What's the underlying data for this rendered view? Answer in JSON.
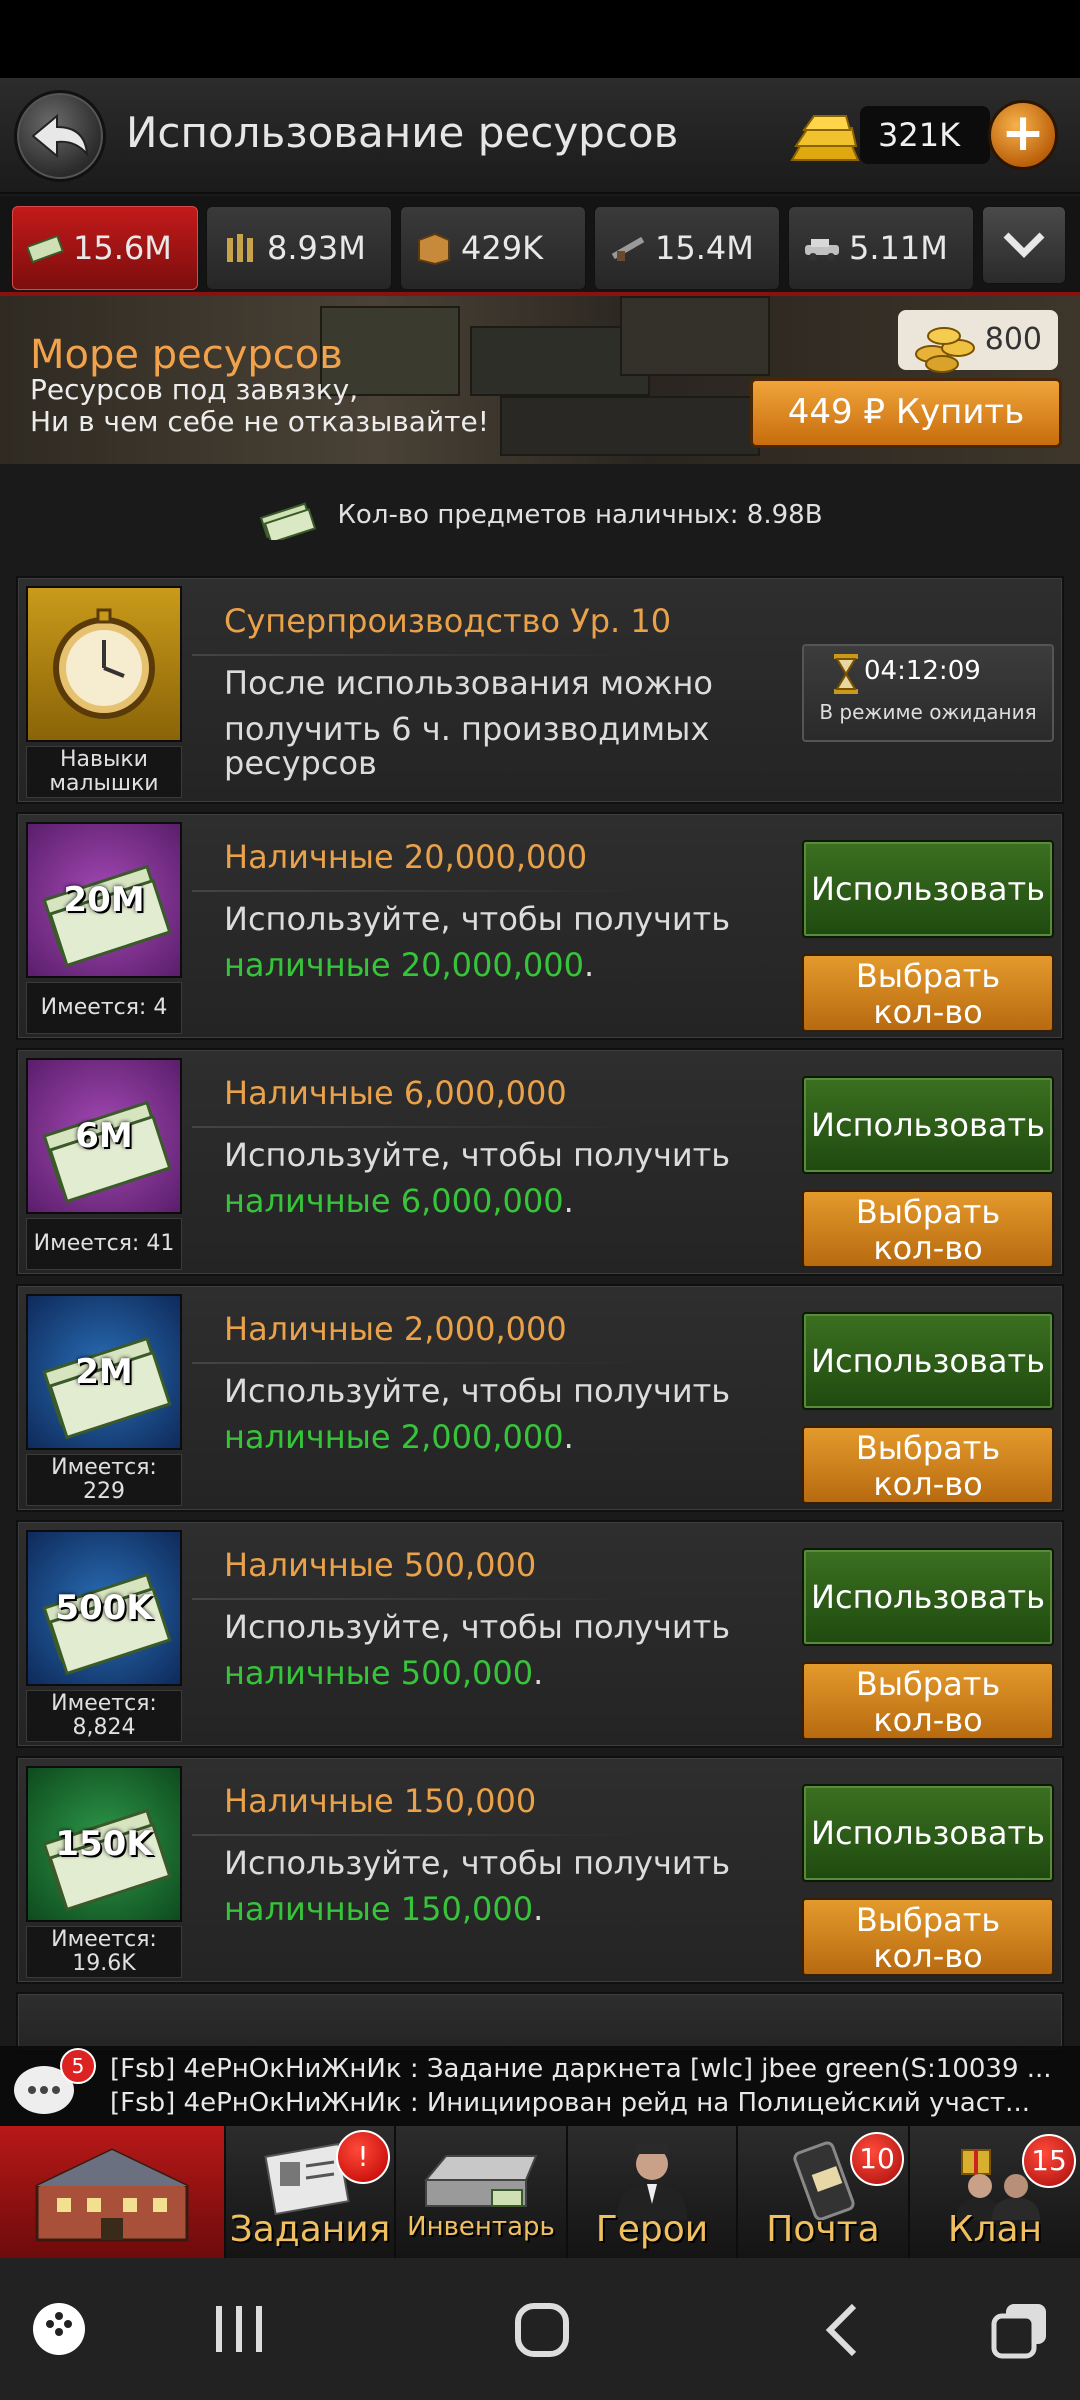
{
  "header": {
    "title": "Использование ресурсов",
    "gold_amount": "321K"
  },
  "resource_tabs": [
    {
      "value": "15.6M",
      "icon": "cash-icon",
      "active": true
    },
    {
      "value": "8.93M",
      "icon": "ammo-icon",
      "active": false
    },
    {
      "value": "429K",
      "icon": "crate-icon",
      "active": false
    },
    {
      "value": "15.4M",
      "icon": "weapon-icon",
      "active": false
    },
    {
      "value": "5.11M",
      "icon": "car-icon",
      "active": false
    }
  ],
  "banner": {
    "title": "Море ресурсов",
    "subtitle_line1": "Ресурсов под завязку,",
    "subtitle_line2": "Ни в чем себе не отказывайте!",
    "coins": "800",
    "buy_label": "449 ₽ Купить"
  },
  "summary": {
    "label": "Кол-во предметов наличных: 8.98B"
  },
  "items": [
    {
      "title": "Суперпроизводство Ур. 10",
      "desc_line1": "После использования можно",
      "desc_line2": "получить 6 ч. производимых",
      "desc_line3": "ресурсов",
      "have_line1": "Навыки",
      "have_line2": "малышки",
      "timer": "04:12:09",
      "status": "В режиме ожидания"
    },
    {
      "thumb": "20M",
      "title": "Наличные 20,000,000",
      "desc_line1": "Используйте, чтобы получить",
      "desc_green": "наличные 20,000,000",
      "desc_dot": ".",
      "have_line1": "Имеется: 4",
      "have_line2": "",
      "use": "Использовать",
      "qty_line1": "Выбрать",
      "qty_line2": "кол-во"
    },
    {
      "thumb": "6M",
      "title": "Наличные 6,000,000",
      "desc_line1": "Используйте, чтобы получить",
      "desc_green": "наличные 6,000,000",
      "desc_dot": ".",
      "have_line1": "Имеется: 41",
      "have_line2": "",
      "use": "Использовать",
      "qty_line1": "Выбрать",
      "qty_line2": "кол-во"
    },
    {
      "thumb": "2M",
      "title": "Наличные 2,000,000",
      "desc_line1": "Используйте, чтобы получить",
      "desc_green": "наличные 2,000,000",
      "desc_dot": ".",
      "have_line1": "Имеется:",
      "have_line2": "229",
      "use": "Использовать",
      "qty_line1": "Выбрать",
      "qty_line2": "кол-во"
    },
    {
      "thumb": "500K",
      "title": "Наличные 500,000",
      "desc_line1": "Используйте, чтобы получить",
      "desc_green": "наличные 500,000",
      "desc_dot": ".",
      "have_line1": "Имеется:",
      "have_line2": "8,824",
      "use": "Использовать",
      "qty_line1": "Выбрать",
      "qty_line2": "кол-во"
    },
    {
      "thumb": "150K",
      "title": "Наличные 150,000",
      "desc_line1": "Используйте, чтобы получить",
      "desc_green": "наличные 150,000",
      "desc_dot": ".",
      "have_line1": "Имеется:",
      "have_line2": "19.6K",
      "use": "Использовать",
      "qty_line1": "Выбрать",
      "qty_line2": "кол-во"
    }
  ],
  "chat": {
    "badge": "5",
    "line1": "[Fsb] 4еРнОкНиЖнИк : Задание даркнета [wlc] jbee green(S:10039 ...",
    "line2": "[Fsb] 4еРнОкНиЖнИк : Инициирован рейд на Полицейский участ..."
  },
  "bottom_nav": [
    {
      "label": "",
      "icon": "base-building-icon",
      "active": true
    },
    {
      "label": "Задания",
      "icon": "tasks-icon",
      "badge": "!"
    },
    {
      "label": "Инвентарь",
      "icon": "inventory-icon"
    },
    {
      "label": "Герои",
      "icon": "heroes-icon"
    },
    {
      "label": "Почта",
      "icon": "mail-icon",
      "badge": "10"
    },
    {
      "label": "Клан",
      "icon": "clan-icon",
      "badge": "15"
    }
  ],
  "colors": {
    "accent_red": "#c31a1a",
    "title_orange": "#e9a14a",
    "green_text": "#37c43a",
    "use_green": "#3b7020",
    "qty_orange": "#e39a2c"
  }
}
